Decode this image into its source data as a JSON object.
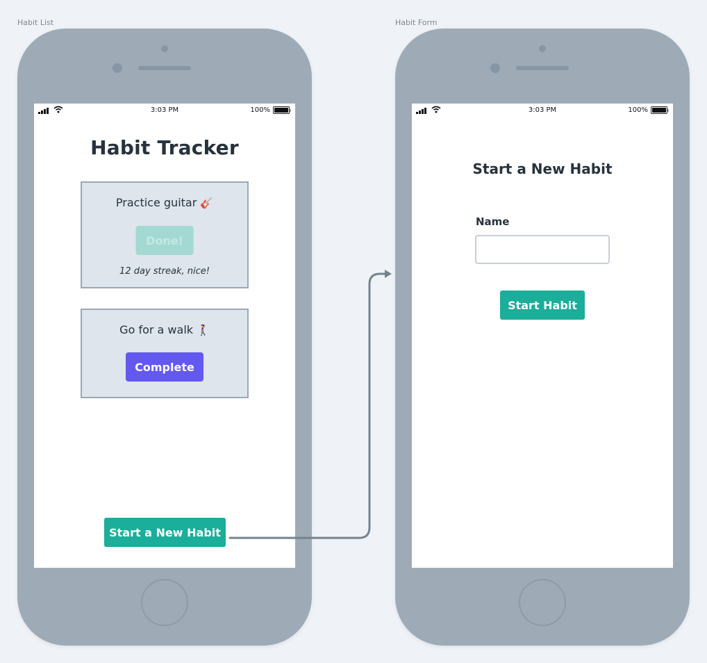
{
  "frames": [
    {
      "label": "Habit List",
      "status_bar": {
        "time": "3:03 PM",
        "battery": "100%"
      },
      "title": "Habit Tracker",
      "habits": [
        {
          "name": "Practice guitar",
          "emoji": "🎸",
          "button_label": "Done!",
          "button_state": "disabled",
          "streak_text": "12 day streak, nice!"
        },
        {
          "name": "Go for a walk",
          "emoji": "🚶‍♀️",
          "button_label": "Complete",
          "button_state": "active"
        }
      ],
      "new_habit_button": "Start a New Habit"
    },
    {
      "label": "Habit Form",
      "status_bar": {
        "time": "3:03 PM",
        "battery": "100%"
      },
      "title": "Start a New Habit",
      "field_label": "Name",
      "field_value": "",
      "submit_button": "Start Habit"
    }
  ],
  "connector": {
    "from": "Start a New Habit",
    "to": "Habit Form"
  },
  "colors": {
    "teal": "#1bae9a",
    "purple": "#6358f0",
    "disabled_teal": "#a4d9d3",
    "card_bg": "#dee5ec",
    "device": "#9eabb7",
    "connector": "#76838f"
  }
}
